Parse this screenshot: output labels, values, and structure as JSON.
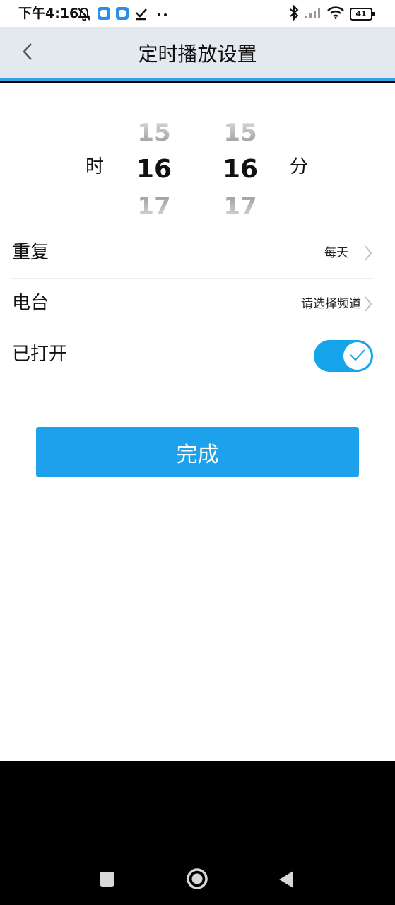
{
  "status_bar": {
    "time": "下午4:16",
    "battery": "41",
    "icons": [
      "mute-bell-icon",
      "app-notification-icon",
      "app-notification-icon",
      "download-done-icon",
      "more-dots-icon",
      "bluetooth-icon",
      "signal-icon",
      "wifi-icon",
      "battery-icon"
    ]
  },
  "header": {
    "title": "定时播放设置",
    "back_icon": "chevron-left-icon"
  },
  "time_picker": {
    "hour": {
      "prev": "15",
      "selected": "16",
      "next": "17",
      "unit": "时"
    },
    "minute": {
      "prev": "15",
      "selected": "16",
      "next": "17",
      "unit": "分"
    }
  },
  "settings": {
    "repeat": {
      "label": "重复",
      "value": "每天"
    },
    "station": {
      "label": "电台",
      "value": "请选择频道"
    },
    "enabled": {
      "label": "已打开",
      "on": true
    }
  },
  "done_button": {
    "label": "完成"
  },
  "nav_bar": {
    "buttons": [
      "recent-apps-icon",
      "home-icon",
      "back-triangle-icon"
    ]
  },
  "colors": {
    "accent": "#1ea1ed",
    "header_bg": "#e4e8ef",
    "header_underline": "#3aa0e2",
    "toggle_on": "#15a4ea"
  }
}
